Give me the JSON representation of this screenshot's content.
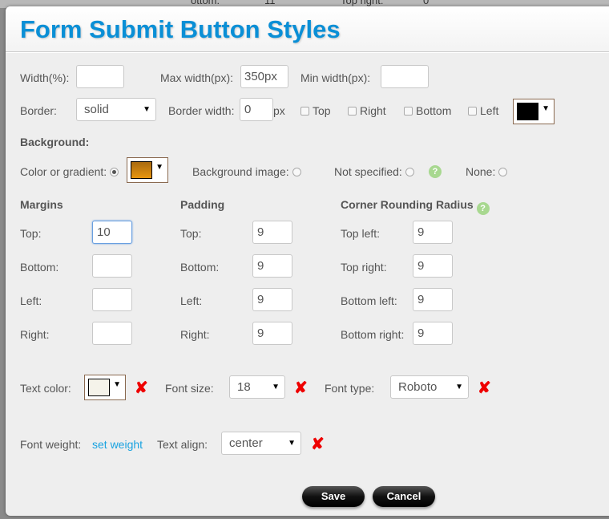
{
  "background": {
    "texts": [
      "ottom:",
      "11",
      "Top right:",
      "0"
    ]
  },
  "dialog": {
    "title": "Form Submit Button Styles"
  },
  "sizes": {
    "width_label": "Width(%):",
    "width_value": "",
    "max_width_label": "Max width(px):",
    "max_width_value": "350px",
    "min_width_label": "Min width(px):",
    "min_width_value": ""
  },
  "border": {
    "label": "Border:",
    "style": "solid",
    "width_label": "Border width:",
    "width_value": "0",
    "unit": "px",
    "sides": [
      "Top",
      "Right",
      "Bottom",
      "Left"
    ],
    "color": "#000000"
  },
  "background_section": {
    "heading": "Background:",
    "color_label": "Color or gradient:",
    "color": "#c07a10",
    "image_label": "Background image:",
    "not_specified_label": "Not specified:",
    "none_label": "None:",
    "selected": "color",
    "help_icon": "?"
  },
  "margins": {
    "heading": "Margins",
    "rows": [
      {
        "label": "Top:",
        "value": "10"
      },
      {
        "label": "Bottom:",
        "value": ""
      },
      {
        "label": "Left:",
        "value": ""
      },
      {
        "label": "Right:",
        "value": ""
      }
    ]
  },
  "padding": {
    "heading": "Padding",
    "rows": [
      {
        "label": "Top:",
        "value": "9"
      },
      {
        "label": "Bottom:",
        "value": "9"
      },
      {
        "label": "Left:",
        "value": "9"
      },
      {
        "label": "Right:",
        "value": "9"
      }
    ]
  },
  "corners": {
    "heading": "Corner Rounding Radius",
    "help_icon": "?",
    "rows": [
      {
        "label": "Top left:",
        "value": "9"
      },
      {
        "label": "Top right:",
        "value": "9"
      },
      {
        "label": "Bottom left:",
        "value": "9"
      },
      {
        "label": "Bottom right:",
        "value": "9"
      }
    ]
  },
  "text": {
    "color_label": "Text color:",
    "color": "#f5f3ea",
    "font_size_label": "Font size:",
    "font_size": "18",
    "font_type_label": "Font type:",
    "font_type": "Roboto",
    "font_weight_label": "Font weight:",
    "font_weight_link": "set weight",
    "align_label": "Text align:",
    "align": "center",
    "clear_icon": "✘"
  },
  "buttons": {
    "save": "Save",
    "cancel": "Cancel"
  }
}
